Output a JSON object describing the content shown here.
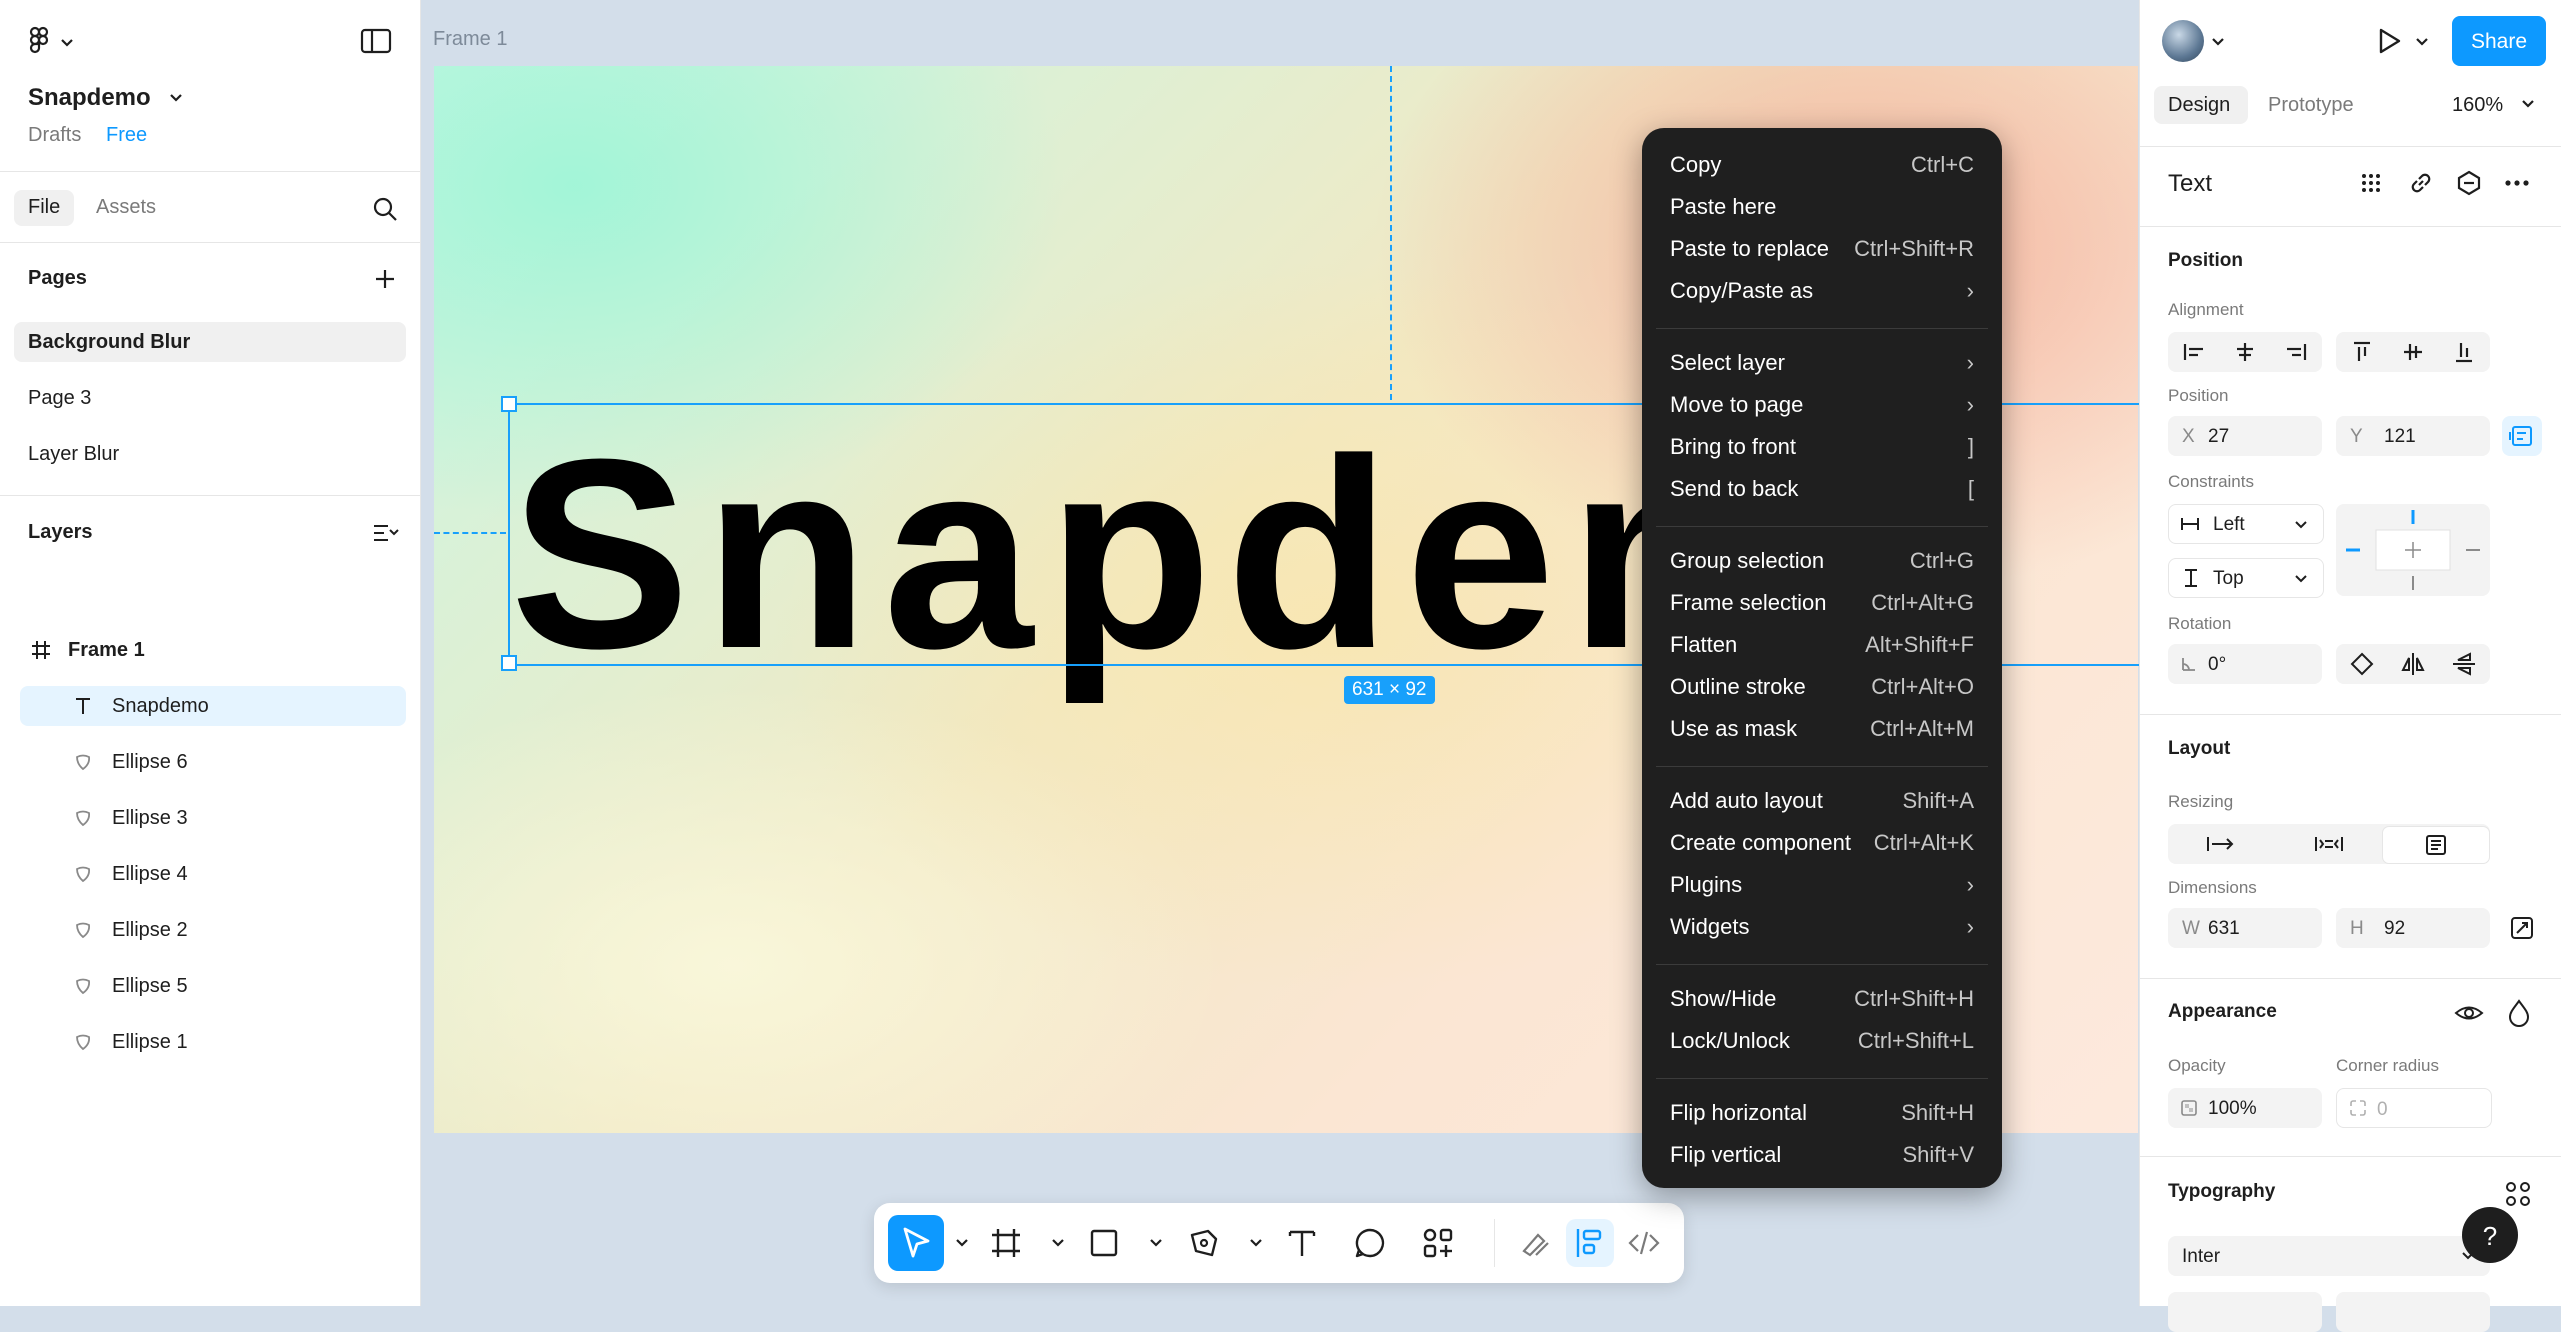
{
  "left_panel": {
    "file_name": "Snapdemo",
    "drafts_label": "Drafts",
    "plan_badge": "Free",
    "tabs": [
      "File",
      "Assets"
    ],
    "pages_header": "Pages",
    "pages": [
      "Background Blur",
      "Page 3",
      "Layer Blur"
    ],
    "layers_header": "Layers",
    "layers": [
      {
        "name": "Frame 1",
        "icon": "frame-icon",
        "indent": 0,
        "selected": false
      },
      {
        "name": "Snapdemo",
        "icon": "text-icon",
        "indent": 1,
        "selected": true
      },
      {
        "name": "Ellipse 6",
        "icon": "ellipse-icon",
        "indent": 1,
        "selected": false
      },
      {
        "name": "Ellipse 3",
        "icon": "ellipse-icon",
        "indent": 1,
        "selected": false
      },
      {
        "name": "Ellipse 4",
        "icon": "ellipse-icon",
        "indent": 1,
        "selected": false
      },
      {
        "name": "Ellipse 2",
        "icon": "ellipse-icon",
        "indent": 1,
        "selected": false
      },
      {
        "name": "Ellipse 5",
        "icon": "ellipse-icon",
        "indent": 1,
        "selected": false
      },
      {
        "name": "Ellipse 1",
        "icon": "ellipse-icon",
        "indent": 1,
        "selected": false
      }
    ]
  },
  "canvas": {
    "frame_label": "Frame 1",
    "text_content": "Snapdemo",
    "dimension_badge": "631 × 92"
  },
  "context_menu": {
    "items": [
      {
        "label": "Copy",
        "shortcut": "Ctrl+C"
      },
      {
        "label": "Paste here",
        "shortcut": ""
      },
      {
        "label": "Paste to replace",
        "shortcut": "Ctrl+Shift+R"
      },
      {
        "label": "Copy/Paste as",
        "shortcut": "›"
      },
      {
        "separator": true
      },
      {
        "label": "Select layer",
        "shortcut": "›"
      },
      {
        "label": "Move to page",
        "shortcut": "›"
      },
      {
        "label": "Bring to front",
        "shortcut": "]"
      },
      {
        "label": "Send to back",
        "shortcut": "["
      },
      {
        "separator": true
      },
      {
        "label": "Group selection",
        "shortcut": "Ctrl+G"
      },
      {
        "label": "Frame selection",
        "shortcut": "Ctrl+Alt+G"
      },
      {
        "label": "Flatten",
        "shortcut": "Alt+Shift+F"
      },
      {
        "label": "Outline stroke",
        "shortcut": "Ctrl+Alt+O"
      },
      {
        "label": "Use as mask",
        "shortcut": "Ctrl+Alt+M"
      },
      {
        "separator": true
      },
      {
        "label": "Add auto layout",
        "shortcut": "Shift+A"
      },
      {
        "label": "Create component",
        "shortcut": "Ctrl+Alt+K"
      },
      {
        "label": "Plugins",
        "shortcut": "›"
      },
      {
        "label": "Widgets",
        "shortcut": "›"
      },
      {
        "separator": true
      },
      {
        "label": "Show/Hide",
        "shortcut": "Ctrl+Shift+H"
      },
      {
        "label": "Lock/Unlock",
        "shortcut": "Ctrl+Shift+L"
      },
      {
        "separator": true
      },
      {
        "label": "Flip horizontal",
        "shortcut": "Shift+H"
      },
      {
        "label": "Flip vertical",
        "shortcut": "Shift+V"
      }
    ]
  },
  "right_panel": {
    "share_label": "Share",
    "tabs": [
      "Design",
      "Prototype"
    ],
    "zoom": "160%",
    "layer_type": "Text",
    "position_header": "Position",
    "alignment_label": "Alignment",
    "position_label": "Position",
    "x_prefix": "X",
    "x_value": "27",
    "y_prefix": "Y",
    "y_value": "121",
    "constraints_label": "Constraints",
    "constraint_h": "Left",
    "constraint_v": "Top",
    "rotation_label": "Rotation",
    "rotation_value": "0°",
    "layout_header": "Layout",
    "resizing_label": "Resizing",
    "dimensions_label": "Dimensions",
    "w_prefix": "W",
    "w_value": "631",
    "h_prefix": "H",
    "h_value": "92",
    "appearance_header": "Appearance",
    "opacity_label": "Opacity",
    "opacity_value": "100%",
    "corner_radius_label": "Corner radius",
    "corner_radius_value": "0",
    "typography_header": "Typography",
    "font_family": "Inter"
  },
  "toolbar": {
    "tools": [
      "move-tool",
      "frame-tool",
      "rectangle-tool",
      "pen-tool",
      "text-tool",
      "comment-tool",
      "actions-tool",
      "draw-mode",
      "design-mode",
      "dev-mode"
    ]
  },
  "help_label": "?",
  "colors": {
    "accent": "#0d99ff",
    "selection": "#18a0fb",
    "menu_bg": "#1f1f1f",
    "canvas_bg": "#d3deea"
  }
}
